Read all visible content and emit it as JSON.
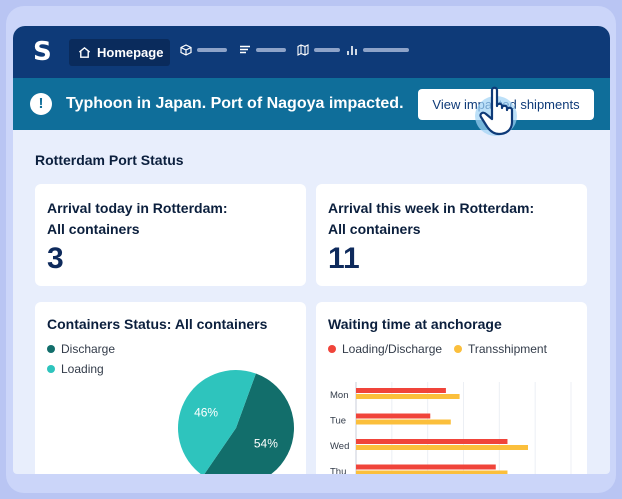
{
  "nav": {
    "logo": "S",
    "home_label": "Homepage"
  },
  "alert": {
    "icon": "!",
    "message": "Typhoon in Japan. Port of Nagoya impacted.",
    "button_label": "View impacted shipments"
  },
  "section": {
    "title": "Rotterdam Port Status"
  },
  "cards": {
    "arrival_today": {
      "title_line1": "Arrival today in Rotterdam:",
      "title_line2": "All containers",
      "value": "3"
    },
    "arrival_week": {
      "title_line1": "Arrival this week in Rotterdam:",
      "title_line2": "All containers",
      "value": "11"
    },
    "containers_status": {
      "title": "Containers Status: All containers"
    },
    "waiting_time": {
      "title": "Waiting time at anchorage"
    }
  },
  "colors": {
    "navy": "#0e3a78",
    "alert": "#0f6e9a",
    "discharge": "#126e6b",
    "loading": "#2ec4bd",
    "loading_discharge": "#f0443a",
    "transshipment": "#fbbf3c"
  },
  "chart_data": [
    {
      "type": "pie",
      "legend": [
        "Discharge",
        "Loading"
      ],
      "values": [
        54,
        46
      ],
      "labels": [
        "54%",
        "46%"
      ],
      "colors": [
        "#126e6b",
        "#2ec4bd"
      ]
    },
    {
      "type": "bar",
      "orientation": "horizontal",
      "categories": [
        "Mon",
        "Tue",
        "Wed",
        "Thu"
      ],
      "series": [
        {
          "name": "Loading/Discharge",
          "color": "#f0443a",
          "values": [
            92,
            76,
            155,
            143
          ]
        },
        {
          "name": "Transshipment",
          "color": "#fbbf3c",
          "values": [
            106,
            97,
            176,
            155
          ]
        }
      ],
      "xlim": [
        0,
        220
      ],
      "grid": true,
      "legend_position": "top"
    }
  ]
}
